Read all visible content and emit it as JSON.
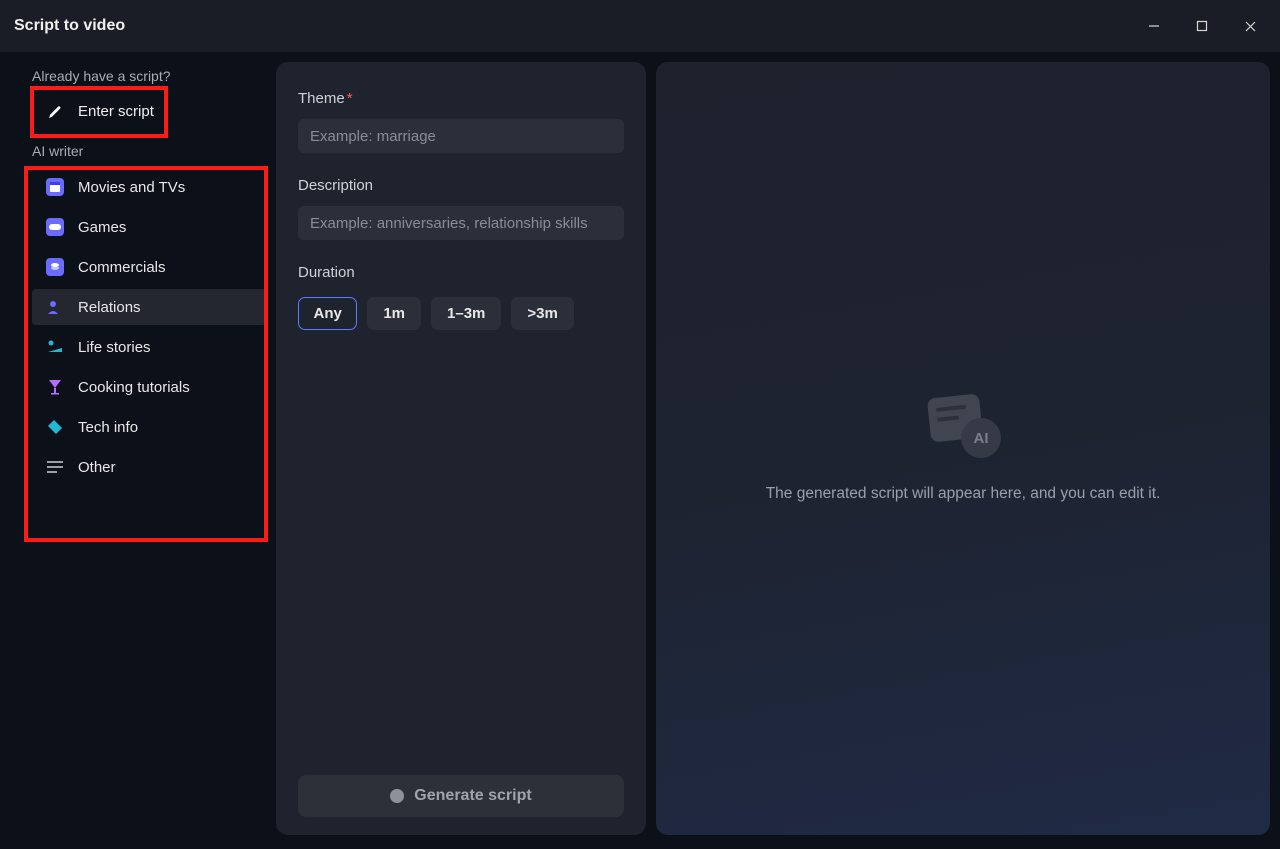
{
  "window": {
    "title": "Script to video"
  },
  "sidebar": {
    "section1": "Already have a script?",
    "enter_script": "Enter script",
    "section2": "AI writer",
    "items": [
      {
        "label": "Movies and TVs",
        "icon": "clapboard-icon",
        "color": "#6b6bff"
      },
      {
        "label": "Games",
        "icon": "gamepad-icon",
        "color": "#6b6bff"
      },
      {
        "label": "Commercials",
        "icon": "coins-icon",
        "color": "#6b6bff"
      },
      {
        "label": "Relations",
        "icon": "person-icon",
        "color": "#6b6bff"
      },
      {
        "label": "Life stories",
        "icon": "sunbath-icon",
        "color": "#22b8d4"
      },
      {
        "label": "Cooking tutorials",
        "icon": "cocktail-icon",
        "color": "#b86bff"
      },
      {
        "label": "Tech info",
        "icon": "tag-icon",
        "color": "#22b8d4"
      },
      {
        "label": "Other",
        "icon": "list-icon",
        "color": "#9aa0ab"
      }
    ],
    "active_index": 3
  },
  "form": {
    "theme_label": "Theme",
    "theme_placeholder": "Example: marriage",
    "description_label": "Description",
    "description_placeholder": "Example: anniversaries, relationship skills",
    "duration_label": "Duration",
    "durations": [
      "Any",
      "1m",
      "1–3m",
      ">3m"
    ],
    "duration_selected": 0,
    "generate_label": "Generate script"
  },
  "preview": {
    "ai_badge": "AI",
    "empty_text": "The generated script will appear here, and you can edit it."
  }
}
